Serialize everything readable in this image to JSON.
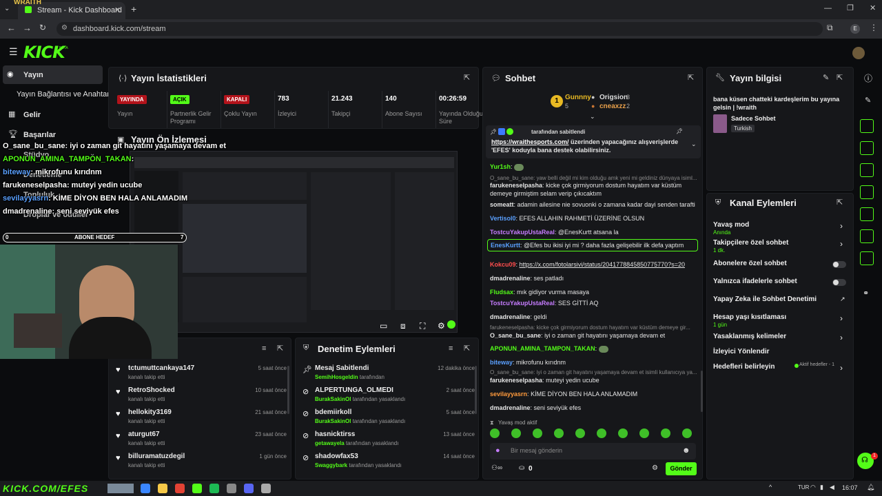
{
  "browser": {
    "tab_title": "Stream - Kick Dashboard",
    "url": "dashboard.kick.com/stream",
    "watermark": "WRAITH",
    "profile_letter": "E"
  },
  "app": {
    "logo": "KICK",
    "logo_small": "BETA"
  },
  "sidebar": {
    "items": [
      {
        "label": "Yayın"
      },
      {
        "label": "Yayın Bağlantısı ve Anahtarı"
      },
      {
        "label": "Gelir"
      },
      {
        "label": "Başarılar"
      },
      {
        "label": "Stüdyo"
      },
      {
        "label": "Denetleme"
      },
      {
        "label": "Topluluk"
      },
      {
        "label": "Droplar ve ödüller"
      }
    ]
  },
  "stats": {
    "title": "Yayın İstatistikleri",
    "cols": [
      {
        "badge": "YAYINDA",
        "label": "Yayın",
        "badge_color": "#b3131b"
      },
      {
        "badge": "AÇIK",
        "label": "Partnerlik Gelir Programı",
        "badge_color": "#53fc18"
      },
      {
        "badge": "KAPALI",
        "label": "Çoklu Yayın",
        "badge_color": "#b3131b"
      },
      {
        "value": "783",
        "label": "İzleyici"
      },
      {
        "value": "21.243",
        "label": "Takipçi"
      },
      {
        "value": "140",
        "label": "Abone Sayısı"
      },
      {
        "value": "00:26:59",
        "label": "Yayında Olduğu Süre"
      }
    ]
  },
  "preview": {
    "title": "Yayın Ön İzlemesi"
  },
  "events": {
    "items": [
      {
        "name": "tctumuttcankaya147",
        "sub": "kanalı takip etti",
        "time": "5 saat önce"
      },
      {
        "name": "RetroShocked",
        "sub": "kanalı takip etti",
        "time": "10 saat önce"
      },
      {
        "name": "hellokity3169",
        "sub": "kanalı takip etti",
        "time": "21 saat önce"
      },
      {
        "name": "aturgut67",
        "sub": "kanalı takip etti",
        "time": "23 saat önce"
      },
      {
        "name": "billuramatuzdegil",
        "sub": "kanalı takip etti",
        "time": "1 gün önce"
      }
    ]
  },
  "moderation": {
    "title": "Denetim Eylemleri",
    "items": [
      {
        "name": "Mesaj Sabitlendi",
        "by": "SemihHosgeldin",
        "action": "tarafından",
        "time": "12 dakika önce"
      },
      {
        "name": "ALPERTUNGA_OLMEDI",
        "by": "BurakSakinOl",
        "action": "tarafından yasaklandı",
        "time": "2 saat önce"
      },
      {
        "name": "bdemiirkoll",
        "by": "BurakSakinOl",
        "action": "tarafından yasaklandı",
        "time": "5 saat önce"
      },
      {
        "name": "hasnicktirss",
        "by": "getawayela",
        "action": "tarafından yasaklandı",
        "time": "13 saat önce"
      },
      {
        "name": "shadowfax53",
        "by": "Swaggybark",
        "action": "tarafından yasaklandı",
        "time": "14 saat önce"
      }
    ]
  },
  "chat": {
    "title": "Sohbet",
    "leaders": {
      "first_name": "Gunnny",
      "first_count": "5",
      "second_name": "Origsion",
      "second_count": "3",
      "third_name": "cneaxzz",
      "third_count": "2"
    },
    "pinned": {
      "by_label": "tarafından sabitlendi",
      "link": "https://wraithesports.com/",
      "text": " üzerinden yapacağınız alışverişlerde 'EFES' koduyla bana destek olabilirsiniz."
    },
    "messages": [
      {
        "user": "Yur1sh",
        "text": "",
        "color": "#53fc18"
      },
      {
        "sys": "O_sane_bu_sane: yaw belli değil mi kim olduğu amk yeni mi geldiniz dünyaya isiml..."
      },
      {
        "user": "farukeneselpasha",
        "text": "kicke çok girmiyorum dostum hayatım var küstüm demeye girmiştim selam verip çıkıcaktım",
        "color": "#e5e5e5"
      },
      {
        "user": "someatt",
        "text": "adamin ailesine nie sovuonki o zamana kadar dayi senden tarafti",
        "color": "#e5e5e5"
      },
      {
        "user": "Vertisol0",
        "text": "EFES ALLAHIN RAHMETİ ÜZERİNE OLSUN",
        "color": "#5aa0ff"
      },
      {
        "user": "TostcuYakupUstaReal",
        "text": "@EnesKurtt atsana la",
        "color": "#c67cff"
      },
      {
        "user": "EnesKurtt",
        "text": "@Efes bu ikisi iyi mi ? daha fazla gelişebilir ilk defa yaptım",
        "color": "#5aa0ff",
        "highlight": true
      },
      {
        "user": "Kokcu09",
        "text": "",
        "link": "https://x.com/fotolarsivi/status/2041778845850775770?s=20",
        "color": "#ff4d4d"
      },
      {
        "user": "dmadrenaline",
        "text": "ses patladı",
        "color": "#e5e5e5"
      },
      {
        "user": "Fludsax",
        "text": "mık gidiyor vurma masaya",
        "color": "#53fc18"
      },
      {
        "user": "TostcuYakupUstaReal",
        "text": "SES GİTTİ AQ",
        "color": "#c67cff"
      },
      {
        "user": "dmadrenaline",
        "text": "geldi",
        "color": "#e5e5e5"
      },
      {
        "sys": "farukeneselpasha: kicke çok girmiyorum dostum hayatım var küstüm demeye gir..."
      },
      {
        "user": "O_sane_bu_sane",
        "text": "iyi o zaman git hayatını yaşamaya devam et",
        "color": "#e5e5e5"
      },
      {
        "user": "APONUN_AMINA_TAMPON_TAKAN",
        "text": "",
        "color": "#53fc18"
      },
      {
        "user": "biteway",
        "text": "mikrofunu kırıdnm",
        "color": "#5aa0ff"
      },
      {
        "sys": "O_sane_bu_sane: iyi o zaman git hayatını yaşamaya devam et isimli kullanıcıya ya..."
      },
      {
        "user": "farukeneselpasha",
        "text": "muteyi yedin ucube",
        "color": "#e5e5e5"
      },
      {
        "user": "sevilayyasrn",
        "text": "KİME DİYON BEN HALA ANLAMADIM",
        "color": "#ff9a3c"
      },
      {
        "user": "dmadrenaline",
        "text": "seni seviyük efes",
        "color": "#e5e5e5"
      }
    ],
    "slow_mode": "Yavaş mod aktif",
    "input_placeholder": "Bir mesaj gönderin",
    "send_label": "Gönder",
    "points": "0"
  },
  "stream_info": {
    "title": "Yayın bilgisi",
    "stream_title": "bana küsen chatteki kardeşlerim bu yayına gelsin | !wraith",
    "category": "Sadece Sohbet",
    "tag": "Turkish"
  },
  "channel_actions": {
    "title": "Kanal Eylemleri",
    "rows": [
      {
        "label": "Yavaş mod",
        "sub": "Anında",
        "control": "chevron"
      },
      {
        "label": "Takipçilere özel sohbet",
        "sub": "1 dk.",
        "control": "chevron"
      },
      {
        "label": "Abonelere özel sohbet",
        "sub": "",
        "control": "toggle"
      },
      {
        "label": "Yalnızca ifadelerle sohbet",
        "sub": "",
        "control": "toggle"
      },
      {
        "label": "Yapay Zeka ile Sohbet Denetimi",
        "sub": "",
        "control": "external"
      },
      {
        "label": "Hesap yaşı kısıtlaması",
        "sub": "1 gün",
        "control": "chevron"
      },
      {
        "label": "Yasaklanmış kelimeler",
        "sub": "",
        "control": "chevron"
      },
      {
        "label": "İzleyici Yönlendir",
        "sub": "",
        "control": "none"
      },
      {
        "label": "Hedefleri belirleyin",
        "sub": "",
        "control": "chevron",
        "note": "Aktif hedefler - 1"
      }
    ]
  },
  "overlay": {
    "chat": [
      {
        "user": "O_sane_bu_sane",
        "text": "iyi o zaman git hayatını yaşamaya devam et"
      },
      {
        "user": "APONUN_AMINA_TAMPON_TAKAN",
        "text": ""
      },
      {
        "user": "biteway",
        "text": "mikrofunu kırıdnm"
      },
      {
        "user": "farukeneselpasha",
        "text": "muteyi yedin ucube"
      },
      {
        "user": "sevilayyasrn",
        "text": "KİME DİYON BEN HALA ANLAMADIM"
      },
      {
        "user": "dmadrenaline",
        "text": "seni seviyük efes"
      }
    ],
    "goal_label": "ABONE HEDEF",
    "goal_min": "0",
    "goal_max": "7",
    "bottom_banner": "KICK.COM/EFES"
  },
  "taskbar": {
    "lang": "TUR",
    "time": "16:07"
  },
  "notification_count": "1"
}
